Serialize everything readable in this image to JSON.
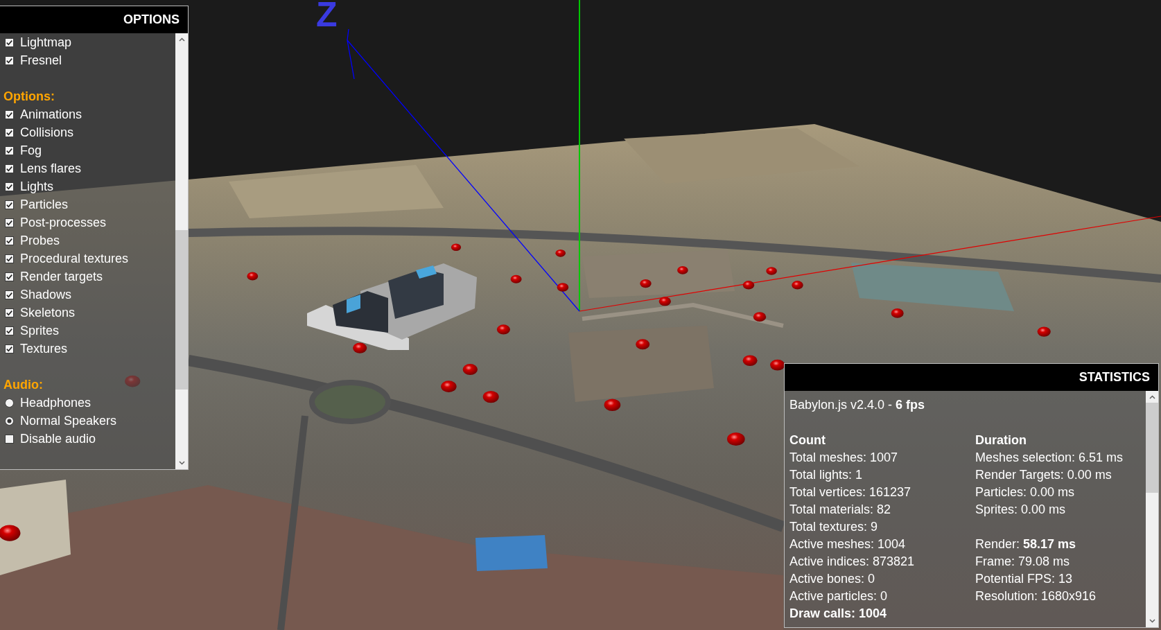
{
  "scene": {
    "axis_label": "Z"
  },
  "options_panel": {
    "title": "OPTIONS",
    "sections": [
      {
        "items": [
          {
            "kind": "checkbox",
            "label": "Lightmap",
            "checked": true
          },
          {
            "kind": "checkbox",
            "label": "Fresnel",
            "checked": true
          }
        ]
      },
      {
        "heading": "Options:",
        "items": [
          {
            "kind": "checkbox",
            "label": "Animations",
            "checked": true
          },
          {
            "kind": "checkbox",
            "label": "Collisions",
            "checked": true
          },
          {
            "kind": "checkbox",
            "label": "Fog",
            "checked": true
          },
          {
            "kind": "checkbox",
            "label": "Lens flares",
            "checked": true
          },
          {
            "kind": "checkbox",
            "label": "Lights",
            "checked": true
          },
          {
            "kind": "checkbox",
            "label": "Particles",
            "checked": true
          },
          {
            "kind": "checkbox",
            "label": "Post-processes",
            "checked": true
          },
          {
            "kind": "checkbox",
            "label": "Probes",
            "checked": true
          },
          {
            "kind": "checkbox",
            "label": "Procedural textures",
            "checked": true
          },
          {
            "kind": "checkbox",
            "label": "Render targets",
            "checked": true
          },
          {
            "kind": "checkbox",
            "label": "Shadows",
            "checked": true
          },
          {
            "kind": "checkbox",
            "label": "Skeletons",
            "checked": true
          },
          {
            "kind": "checkbox",
            "label": "Sprites",
            "checked": true
          },
          {
            "kind": "checkbox",
            "label": "Textures",
            "checked": true
          }
        ]
      },
      {
        "heading": "Audio:",
        "items": [
          {
            "kind": "radio",
            "label": "Headphones",
            "selected": false
          },
          {
            "kind": "radio",
            "label": "Normal Speakers",
            "selected": true
          },
          {
            "kind": "checkbox",
            "label": "Disable audio",
            "checked": false
          }
        ]
      }
    ]
  },
  "statistics_panel": {
    "title": "STATISTICS",
    "summary": "Babylon.js v2.4.0 - **6 fps**",
    "columns": [
      {
        "heading": "Count",
        "groups": [
          [
            "Total meshes: 1007",
            "Total lights: 1",
            "Total vertices: 161237",
            "Total materials: 82",
            "Total textures: 9",
            "Active meshes: 1004",
            "Active indices: 873821",
            "Active bones: 0",
            "Active particles: 0"
          ]
        ],
        "footer": "Draw calls: 1004"
      },
      {
        "heading": "Duration",
        "groups": [
          [
            "Meshes selection: 6.51 ms",
            "Render Targets: 0.00 ms",
            "Particles: 0.00 ms",
            "Sprites: 0.00 ms"
          ],
          [
            "Render: **58.17 ms**",
            "Frame: 79.08 ms",
            "Potential FPS: 13",
            "Resolution: 1680x916"
          ]
        ]
      }
    ]
  }
}
